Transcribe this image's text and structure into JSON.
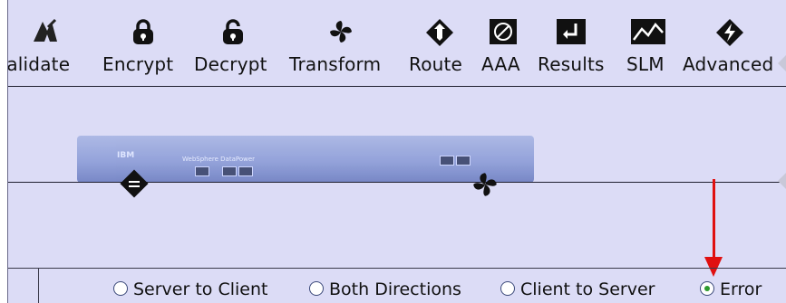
{
  "toolbar": {
    "items": [
      {
        "label": "Validate",
        "icon": "validate-icon"
      },
      {
        "label": "Encrypt",
        "icon": "lock-closed-icon"
      },
      {
        "label": "Decrypt",
        "icon": "lock-open-icon"
      },
      {
        "label": "Transform",
        "icon": "transform-swirl-icon"
      },
      {
        "label": "Route",
        "icon": "route-diamond-icon"
      },
      {
        "label": "AAA",
        "icon": "no-entry-icon"
      },
      {
        "label": "Results",
        "icon": "results-return-icon"
      },
      {
        "label": "SLM",
        "icon": "slm-graph-icon"
      },
      {
        "label": "Advanced",
        "icon": "lightning-diamond-icon"
      }
    ]
  },
  "device": {
    "brand": "IBM",
    "model": "WebSphere DataPower"
  },
  "direction": {
    "options": [
      "Server to Client",
      "Both Directions",
      "Client to Server",
      "Error"
    ],
    "selected": "Error"
  },
  "colors": {
    "background": "#dcdcf6",
    "annotation_arrow": "#e01010",
    "radio_selected": "#2e9a2e"
  }
}
